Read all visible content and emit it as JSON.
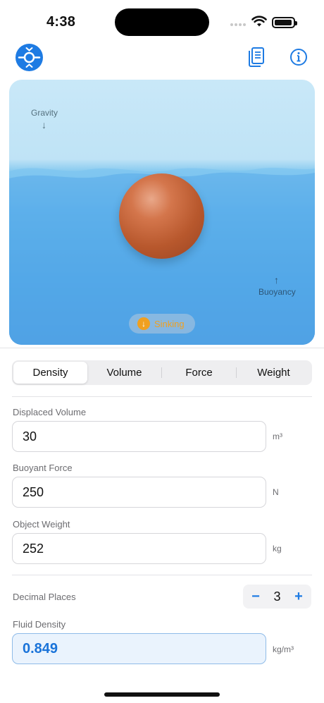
{
  "status_bar": {
    "time": "4:38"
  },
  "header": {
    "app_icon": "buoyancy-logo-icon",
    "doc_icon": "book-icon",
    "info_icon": "info-icon"
  },
  "simulation": {
    "gravity_label": "Gravity",
    "gravity_arrow": "↓",
    "buoyancy_label": "Buoyancy",
    "buoyancy_arrow": "↑",
    "status_label": "Sinking",
    "status_icon": "down-arrow-icon",
    "status_color": "#f0a020"
  },
  "tabs": [
    {
      "label": "Density",
      "active": true
    },
    {
      "label": "Volume",
      "active": false
    },
    {
      "label": "Force",
      "active": false
    },
    {
      "label": "Weight",
      "active": false
    }
  ],
  "fields": {
    "displaced_volume": {
      "label": "Displaced Volume",
      "value": "30",
      "unit": "m³"
    },
    "buoyant_force": {
      "label": "Buoyant Force",
      "value": "250",
      "unit": "N"
    },
    "object_weight": {
      "label": "Object Weight",
      "value": "252",
      "unit": "kg"
    }
  },
  "decimal_places": {
    "label": "Decimal Places",
    "value": "3",
    "minus": "−",
    "plus": "+"
  },
  "result": {
    "label": "Fluid Density",
    "value": "0.849",
    "unit": "kg/m³"
  },
  "colors": {
    "accent": "#1e7be3",
    "water": "#2f8fe0",
    "object": "#b8582d"
  }
}
